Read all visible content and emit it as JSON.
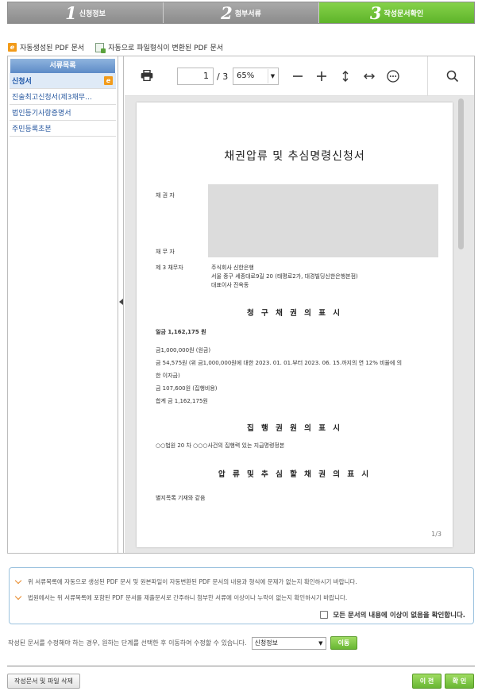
{
  "steps": [
    {
      "num": "1",
      "label": "신청정보"
    },
    {
      "num": "2",
      "label": "첨부서류"
    },
    {
      "num": "3",
      "label": "작성문서확인"
    }
  ],
  "legend": {
    "auto_pdf": "자동생성된 PDF 문서",
    "converted_pdf": "자동으로 파일형식이 변환된 PDF 문서"
  },
  "sidebar": {
    "title": "서류목록",
    "items": [
      {
        "label": "신청서"
      },
      {
        "label": "진술최고신청서(제3채무…"
      },
      {
        "label": "법인등기사항증명서"
      },
      {
        "label": "주민등록초본"
      }
    ]
  },
  "viewer": {
    "page_current": "1",
    "page_total": "/ 3",
    "zoom": "65%"
  },
  "document": {
    "title": "채권압류 및 추심명령신청서",
    "creditor_label": "채 권 자",
    "debtor_label": "채 무 자",
    "third_debtor_label": "제 3 채무자",
    "third_debtor_lines": [
      "주식회사 신한은행",
      "서울 중구 세종대로9길 20 (태평로2가, 대경빌딩신한은행본점)",
      "대표이사 진옥동"
    ],
    "sec1_title": "청 구 채 권 의 표 시",
    "claim_total": "일금 1,162,175 원",
    "claim_lines": [
      "금1,000,000원  (원금)",
      "금 54,575원 (위 금1,000,000원에 대한 2023. 01. 01.부터 2023. 06. 15.까지의 연 12% 비율에 의",
      "한 이자금)",
      "금 107,600원  (집행비용)",
      "합계  금 1,162,175원"
    ],
    "sec2_title": "집 행 권 원 의 표 시",
    "sec2_line": "○○법원 20  차   ○○○사건의 집행력 있는 지급명령정본",
    "sec3_title": "압 류 및 추 심 할 채 권 의 표 시",
    "sec3_line": "별지목록 기재와 같음",
    "page_footer": "1/3"
  },
  "notice": {
    "line1": "위 서류목록에 자동으로 생성된 PDF 문서 및 원본파일이 자동변환된 PDF 문서의 내용과 형식에 문제가 없는지 확인하시기 바랍니다.",
    "line2": "법원에서는 위 서류목록에 포함된 PDF 문서를 제출문서로 간주하니 첨부한 서류에 이상이나 누락이 없는지 확인하시기 바랍니다.",
    "confirm_label": "모든 문서의 내용에 이상이 없음을 확인합니다."
  },
  "edit": {
    "text": "작성된 문서를 수정해야 하는 경우, 원하는 단계를 선택한 후 이동하여 수정할 수 있습니다.",
    "select_value": "신청정보",
    "move_button": "이동"
  },
  "buttons": {
    "delete": "작성문서 및 파일 삭제",
    "prev": "이 전",
    "ok": "확 인"
  },
  "colors": {
    "active_step": "#6cc035",
    "sidebar_header": "#6f99d0",
    "badge": "#f29b1a",
    "notice_border": "#9cc3df"
  }
}
